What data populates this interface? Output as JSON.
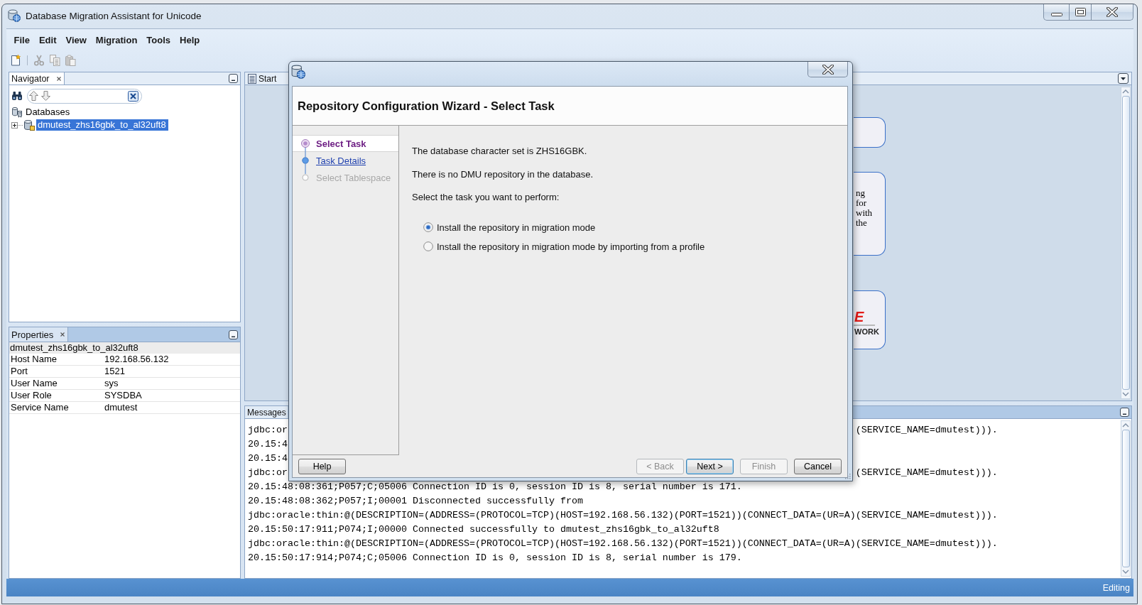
{
  "window": {
    "title": "Database Migration Assistant for Unicode"
  },
  "menu": [
    {
      "label": "File"
    },
    {
      "label": "Edit"
    },
    {
      "label": "View"
    },
    {
      "label": "Migration"
    },
    {
      "label": "Tools"
    },
    {
      "label": "Help"
    }
  ],
  "toolbar": {
    "groups": [
      {
        "items": [
          {
            "kind": "new",
            "disabled": false
          }
        ]
      },
      {
        "items": [
          {
            "kind": "cut",
            "disabled": true
          },
          {
            "kind": "copy",
            "disabled": true
          },
          {
            "kind": "paste",
            "disabled": true
          }
        ]
      }
    ]
  },
  "navigator": {
    "tab": "Navigator",
    "tree": [
      {
        "label": "Databases",
        "selected": false,
        "children": [
          {
            "label": "dmutest_zhs16gbk_to_al32uft8",
            "selected": true,
            "expanded": false
          }
        ]
      }
    ]
  },
  "properties": {
    "tab": "Properties",
    "header": "dmutest_zhs16gbk_to_al32uft8",
    "rows": [
      {
        "name": "Host Name",
        "value": "192.168.56.132"
      },
      {
        "name": "Port",
        "value": "1521"
      },
      {
        "name": "User Name",
        "value": "sys"
      },
      {
        "name": "User Role",
        "value": "SYSDBA"
      },
      {
        "name": "Service Name",
        "value": "dmutest"
      }
    ]
  },
  "editor": {
    "tab": "Start",
    "cards": [
      {
        "kind": "blank"
      },
      {
        "kind": "text",
        "lines": [
          "ng",
          "for",
          "with",
          "the"
        ]
      },
      {
        "kind": "logo",
        "mark": "E",
        "text": "WORK"
      }
    ]
  },
  "messages": {
    "tab": "Messages",
    "lines": [
      {
        "text": "jdbc:or",
        "tail": "(SERVICE_NAME=dmutest)))."
      },
      {
        "text": "20.15:4"
      },
      {
        "text": "20.15:4"
      },
      {
        "text": "jdbc:or",
        "tail": "(SERVICE_NAME=dmutest)))."
      },
      {
        "text": "20.15:48:08:361;P057;C;05006 Connection ID is 0, session ID is 8, serial number is 171."
      },
      {
        "text": "20.15:48:08:362;P057;I;00001 Disconnected successfully from"
      },
      {
        "text": "jdbc:oracle:thin:@(DESCRIPTION=(ADDRESS=(PROTOCOL=TCP)(HOST=192.168.56.132)(PORT=1521))(CONNECT_DATA=(UR=A)(SERVICE_NAME=dmutest)))."
      },
      {
        "text": "20.15:50:17:911;P074;I;00000 Connected successfully to dmutest_zhs16gbk_to_al32uft8"
      },
      {
        "text": "jdbc:oracle:thin:@(DESCRIPTION=(ADDRESS=(PROTOCOL=TCP)(HOST=192.168.56.132)(PORT=1521))(CONNECT_DATA=(UR=A)(SERVICE_NAME=dmutest)))."
      },
      {
        "text": "20.15:50:17:914;P074;C;05006 Connection ID is 0, session ID is 8, serial number is 179."
      }
    ]
  },
  "status_bar": {
    "text": "Editing"
  },
  "dialog": {
    "title": "Repository Configuration Wizard - Select Task",
    "steps": [
      {
        "label": "Select Task",
        "selected": true,
        "disabled": false
      },
      {
        "label": "Task Details",
        "selected": false,
        "disabled": false
      },
      {
        "label": "Select Tablespace",
        "selected": false,
        "disabled": true
      }
    ],
    "paragraphs": [
      "The database character set is ZHS16GBK.",
      "There is no DMU repository in the database.",
      "Select the task you want to perform:"
    ],
    "options": [
      {
        "label": "Install the repository in migration mode",
        "selected": true
      },
      {
        "label": "Install the repository in migration mode by importing from a profile",
        "selected": false
      }
    ],
    "help_button": {
      "label": "Help"
    },
    "buttons": [
      {
        "label": "< Back",
        "disabled": true,
        "default": false
      },
      {
        "label": "Next >",
        "disabled": false,
        "default": true
      },
      {
        "label": "Finish",
        "disabled": true,
        "default": false
      },
      {
        "label": "Cancel",
        "disabled": false,
        "default": false
      }
    ]
  }
}
